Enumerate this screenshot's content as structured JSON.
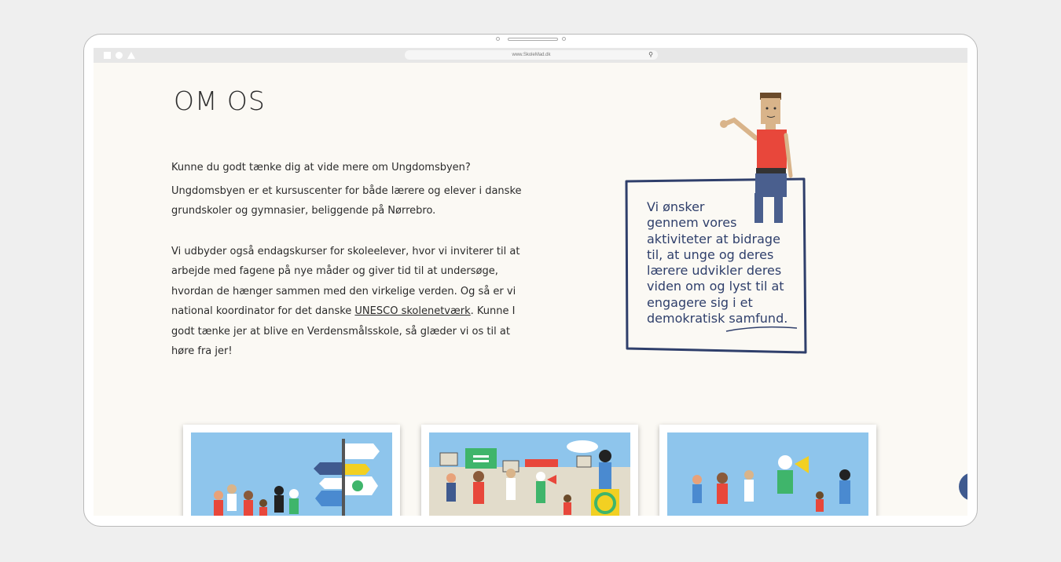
{
  "browser": {
    "url": "www.SkoleMad.dk"
  },
  "page": {
    "title": "OM OS",
    "intro_question": "Kunne du godt tænke dig at vide mere om Ungdomsbyen?",
    "description": "Ungdomsbyen er et kursuscenter for både lærere og elever i danske grundskoler og gymnasier, beliggende på Nørrebro.",
    "paragraph_before_link": "Vi udbyder også endagskurser for skoleelever, hvor vi inviterer til at arbejde med fagene på nye måder og giver tid til at undersøge, hvordan de hænger sammen med den virkelige verden. Og så er vi national koordinator for det danske ",
    "link_text": "UNESCO skolenetværk",
    "paragraph_after_link": ". Kunne I godt tænke jer at blive en Verdensmålsskole, så glæder vi os til at høre fra jer!"
  },
  "quote": {
    "lines": [
      "Vi ønsker",
      "gennem vores",
      "aktiviteter at bidrage",
      "til, at unge og deres",
      "lærere udvikler deres",
      "viden om og lyst til at",
      "engagere sig i et",
      "demokratisk samfund."
    ]
  },
  "cards": [
    {
      "name": "signpost-illustration"
    },
    {
      "name": "protest-illustration"
    },
    {
      "name": "megaphone-illustration"
    }
  ],
  "colors": {
    "page_bg": "#fbf9f4",
    "quote_blue": "#2f3f6b",
    "sky": "#8ec5ec",
    "accent_red": "#e8473b",
    "accent_green": "#3fb56b",
    "accent_yellow": "#f2d022"
  }
}
